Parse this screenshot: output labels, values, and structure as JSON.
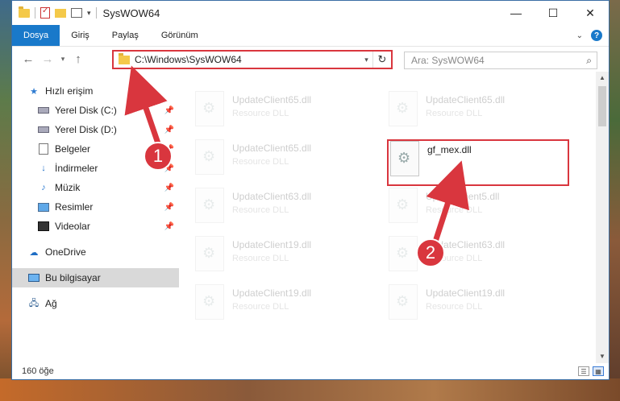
{
  "window": {
    "title": "SysWOW64"
  },
  "ribbon": {
    "tabs": [
      "Dosya",
      "Giriş",
      "Paylaş",
      "Görünüm"
    ]
  },
  "navigation": {
    "address_path": "C:\\Windows\\SysWOW64",
    "search_placeholder": "Ara: SysWOW64"
  },
  "sidebar": {
    "quick_access": "Hızlı erişim",
    "items": [
      {
        "label": "Yerel Disk (C:)",
        "icon": "drive-icon",
        "pinned": true
      },
      {
        "label": "Yerel Disk (D:)",
        "icon": "drive-icon",
        "pinned": true
      },
      {
        "label": "Belgeler",
        "icon": "documents-icon",
        "pinned": true
      },
      {
        "label": "İndirmeler",
        "icon": "downloads-icon",
        "pinned": true
      },
      {
        "label": "Müzik",
        "icon": "music-icon",
        "pinned": true
      },
      {
        "label": "Resimler",
        "icon": "pictures-icon",
        "pinned": true
      },
      {
        "label": "Videolar",
        "icon": "videos-icon",
        "pinned": true
      }
    ],
    "onedrive": "OneDrive",
    "this_pc": "Bu bilgisayar",
    "network": "Ağ"
  },
  "files": {
    "left_column": [
      {
        "name": "UpdateClient65.dll",
        "type": "Resource DLL"
      },
      {
        "name": "UpdateClient65.dll",
        "type": "Resource DLL"
      },
      {
        "name": "UpdateClient63.dll",
        "type": "Resource DLL"
      },
      {
        "name": "UpdateClient19.dll",
        "type": "Resource DLL"
      },
      {
        "name": "UpdateClient19.dll",
        "type": "Resource DLL"
      }
    ],
    "right_column": [
      {
        "name": "UpdateClient65.dll",
        "type": "Resource DLL"
      },
      {
        "name": "gf_mex.dll",
        "type": ""
      },
      {
        "name": "UpdateClient5.dll",
        "type": "Resource DLL"
      },
      {
        "name": "UpdateClient63.dll",
        "type": "Resource DLL"
      },
      {
        "name": "UpdateClient19.dll",
        "type": "Resource DLL"
      }
    ]
  },
  "status": {
    "item_count": "160 öğe"
  },
  "annotations": {
    "marker_1": "1",
    "marker_2": "2",
    "color": "#d9363e"
  },
  "colors": {
    "accent": "#1979ca",
    "highlight": "#d9363e"
  }
}
